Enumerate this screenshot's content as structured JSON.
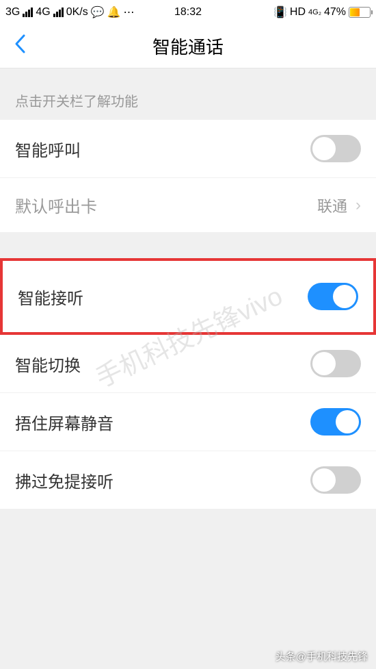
{
  "statusBar": {
    "network1": "3G",
    "network2": "4G",
    "speed": "0K/s",
    "time": "18:32",
    "hd": "HD",
    "g4": "4G₂",
    "battery": "47%"
  },
  "nav": {
    "title": "智能通话"
  },
  "sectionHeader": "点击开关栏了解功能",
  "items": {
    "smartCall": {
      "label": "智能呼叫",
      "on": false
    },
    "defaultCard": {
      "label": "默认呼出卡",
      "value": "联通"
    },
    "smartAnswer": {
      "label": "智能接听",
      "on": true
    },
    "smartSwitch": {
      "label": "智能切换",
      "on": false
    },
    "coverMute": {
      "label": "捂住屏幕静音",
      "on": true
    },
    "waveAnswer": {
      "label": "拂过免提接听",
      "on": false
    }
  },
  "watermark": "手机科技先锋vivo",
  "footer": "头条@手机科技先锋"
}
